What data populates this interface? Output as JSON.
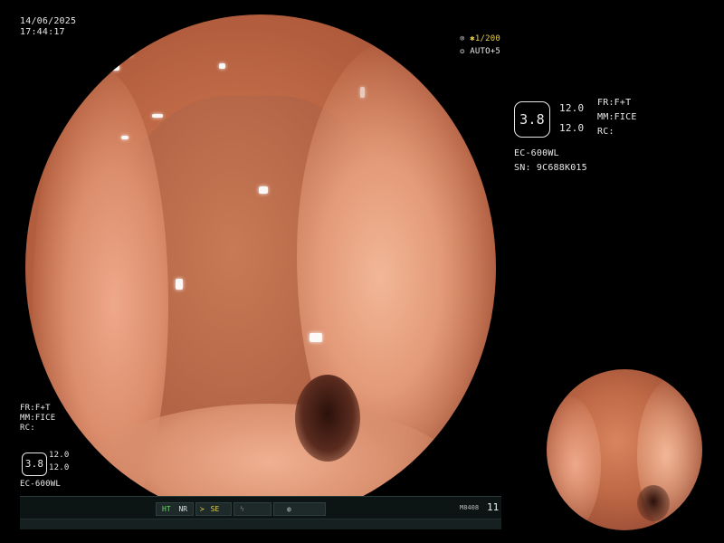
{
  "timestamp": {
    "date": "14/06/2025",
    "time": "17:44:17"
  },
  "top_right_indicators": {
    "shutter": "1/200",
    "auto": "AUTO+5"
  },
  "info_panel": {
    "hex_value": "3.8",
    "value_1": "12.0",
    "value_2": "12.0",
    "fr": "FR:F+T",
    "mm": "MM:FICE",
    "rc": "RC:",
    "scope": "EC-600WL",
    "serial": "SN: 9C688K015"
  },
  "left_panel": {
    "fr": "FR:F+T",
    "mm": "MM:FICE",
    "rc": "RC:",
    "hex_value": "3.8",
    "value_1": "12.0",
    "value_2": "12.0",
    "scope": "EC-600WL"
  },
  "statusbar": {
    "ht": "HT",
    "nr": "NR",
    "se": "SE",
    "code": "M8408",
    "number": "11"
  },
  "colors": {
    "background": "#000000",
    "mucosa": "#c06a47",
    "status_green": "#6fd36f",
    "indicator_yellow": "#e8d24a"
  },
  "icons": {
    "shutter": "aperture-icon",
    "auto": "auto-exposure-icon",
    "se": "structure-enhance-icon",
    "freeze": "freeze-icon",
    "record": "record-icon"
  }
}
